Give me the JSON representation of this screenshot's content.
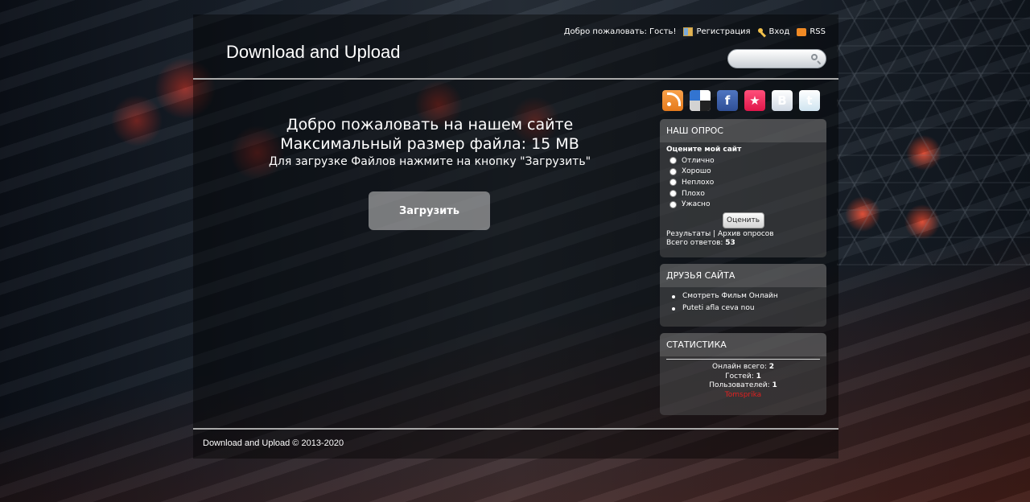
{
  "header": {
    "site_title": "Download and Upload",
    "greeting": "Добро пожаловать: Гость!",
    "register": "Регистрация",
    "login": "Вход",
    "rss": "RSS",
    "search_placeholder": ""
  },
  "main": {
    "welcome_line1": "Добро пожаловать на нашем сайте",
    "welcome_line2": "Максимальный размер файла: 15 MB",
    "welcome_line3": "Для загрузке Файлов нажмите на кнопку \"Загрузить\"",
    "upload_label": "Загрузить"
  },
  "social": {
    "fb": "f",
    "vk": "B",
    "tw": "t",
    "fav": "★"
  },
  "poll": {
    "title": "НАШ ОПРОС",
    "question": "Оцените мой сайт",
    "options": [
      "Отлично",
      "Хорошо",
      "Неплохо",
      "Плохо",
      "Ужасно"
    ],
    "vote_label": "Оценить",
    "results": "Результаты",
    "archive": "Архив опросов",
    "separator": " | ",
    "total_label": "Всего ответов: ",
    "total_value": "53"
  },
  "friends": {
    "title": "ДРУЗЬЯ САЙТА",
    "items": [
      "Смотреть Фильм Онлайн",
      "Puteti afla ceva nou"
    ]
  },
  "stats": {
    "title": "СТАТИСТИКА",
    "online_label": "Онлайн всего: ",
    "online_value": "2",
    "guests_label": "Гостей: ",
    "guests_value": "1",
    "users_label": "Пользователей: ",
    "users_value": "1",
    "user_name": "Tomsprika"
  },
  "footer": {
    "copyright": "Download and Upload © 2013-2020"
  },
  "colors": {
    "accent_red": "#e02020",
    "divider": "#a9a9a9"
  }
}
